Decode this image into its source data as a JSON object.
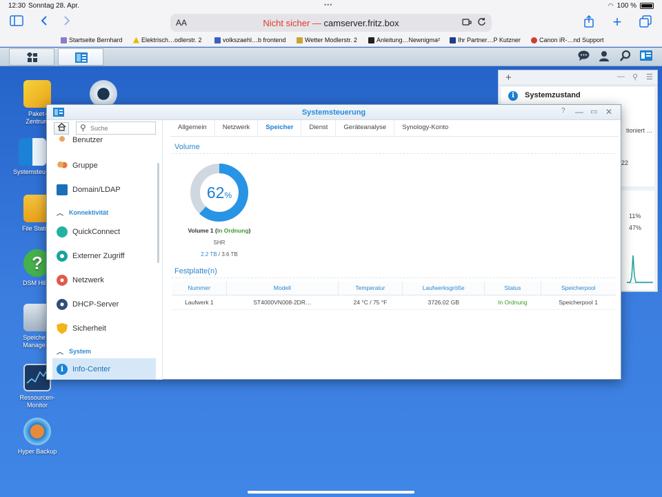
{
  "status_bar": {
    "time": "12:30",
    "date": "Sonntag 28. Apr.",
    "battery": "100 %"
  },
  "browser": {
    "aa": "AA",
    "url_insecure": "Nicht sicher —",
    "url_host": "camserver.fritz.box",
    "bookmarks": [
      {
        "label": "Startseite Bernhard",
        "color": "#8a7dc8"
      },
      {
        "label": "Elektrisch…odlerstr. 2",
        "color": "#e8b900"
      },
      {
        "label": "volkszaehl…b frontend",
        "color": "#3b5fc0"
      },
      {
        "label": "Wetter Modlerstr. 2",
        "color": "#caa332"
      },
      {
        "label": "Anleitung…Newnigma²",
        "color": "#222222"
      },
      {
        "label": "Ihr Partner…P Kutzner",
        "color": "#1e3f8a"
      },
      {
        "label": "Canon iR-…nd Support",
        "color": "#d23b2f"
      }
    ]
  },
  "desktop_icons": [
    {
      "label": "Paket-\nZentrum"
    },
    {
      "label": "Systemsteu…"
    },
    {
      "label": "File Stati…"
    },
    {
      "label": "DSM Hil…"
    },
    {
      "label": "Speiche…\nManage…"
    },
    {
      "label": "Ressourcen-\nMonitor"
    },
    {
      "label": "Hyper Backup"
    }
  ],
  "widget": {
    "title": "Systemzustand",
    "snip1": "tioniert …",
    "snip2": "22",
    "val1": "11%",
    "val2": "47%"
  },
  "window": {
    "title": "Systemsteuerung",
    "help_icon": "?",
    "search_placeholder": "Suche",
    "nav": {
      "benutzer": "Benutzer",
      "gruppe": "Gruppe",
      "domain": "Domain/LDAP",
      "sec_konnektivitaet": "Konnektivität",
      "quickconnect": "QuickConnect",
      "externer": "Externer Zugriff",
      "netzwerk": "Netzwerk",
      "dhcp": "DHCP-Server",
      "sicherheit": "Sicherheit",
      "sec_system": "System",
      "infocenter": "Info-Center"
    },
    "tabs": [
      "Allgemein",
      "Netzwerk",
      "Speicher",
      "Dienst",
      "Geräteanalyse",
      "Synology-Konto"
    ],
    "active_tab": "Speicher",
    "volume": {
      "section": "Volume",
      "percent": 62,
      "percent_num": "62",
      "percent_sign": "%",
      "name": "Volume 1",
      "status": "In Ordnung",
      "type": "SHR",
      "used": "2.2 TB",
      "total": "/ 3.6 TB"
    },
    "disks": {
      "section": "Festplatte(n)",
      "headers": [
        "Nummer",
        "Modell",
        "Temperatur",
        "Laufwerksgröße",
        "Status",
        "Speicherpool"
      ],
      "rows": [
        [
          "Laufwerk 1",
          "ST4000VN008-2DR…",
          "24 °C / 75 °F",
          "3726.02 GB",
          "In Ordnung",
          "Speicherpool 1"
        ]
      ]
    }
  }
}
